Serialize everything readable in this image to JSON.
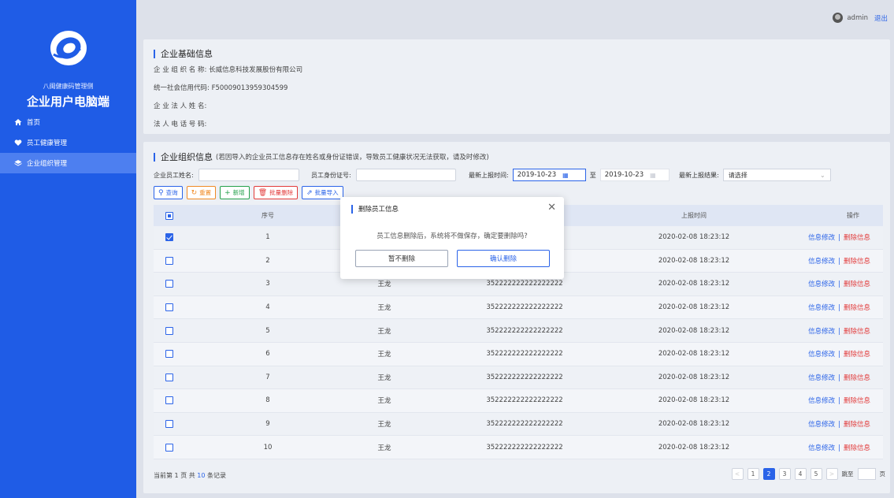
{
  "sidebar": {
    "org": "八闽健康码管理侧",
    "title": "企业用户电脑端",
    "items": [
      {
        "label": "首页",
        "icon": "home-icon"
      },
      {
        "label": "员工健康管理",
        "icon": "heart-icon"
      },
      {
        "label": "企业组织管理",
        "icon": "layers-icon"
      }
    ]
  },
  "topbar": {
    "user": "admin",
    "logout": "退出"
  },
  "basic": {
    "title": "企业基础信息",
    "rows": [
      "企 业 组 织 名 称:  长威信息科技发展股份有限公司",
      "统一社会信用代码:  F50009013959304599",
      "企 业 法 人 姓 名:",
      "法 人 电 话 号 码:"
    ]
  },
  "org": {
    "title": "企业组织信息",
    "note": "(若因导入的企业员工信息存在姓名或身份证错误，导致员工健康状况无法获取，请及时修改)",
    "filters": {
      "name_label": "企业员工姓名:",
      "id_label": "员工身份证号:",
      "date_label": "最新上报时间:",
      "date_from": "2019-10-23",
      "date_sep": "至",
      "date_to": "2019-10-23",
      "result_label": "最新上报结果:",
      "result_value": "请选择"
    },
    "buttons": {
      "query": "查询",
      "reset": "重置",
      "add": "新增",
      "batch_delete": "批量删除",
      "batch_import": "批量导入"
    },
    "table": {
      "headers": {
        "no": "序号",
        "time": "上报时间",
        "op": "操作"
      },
      "edit": "信息修改",
      "sep": "|",
      "delete": "删除信息",
      "rows": [
        {
          "no": "1",
          "name": "",
          "id": "",
          "time": "2020-02-08 18:23:12",
          "checked": true
        },
        {
          "no": "2",
          "name": "",
          "id": "",
          "time": "2020-02-08 18:23:12",
          "checked": false
        },
        {
          "no": "3",
          "name": "王龙",
          "id": "352222222222222222",
          "time": "2020-02-08 18:23:12",
          "checked": false
        },
        {
          "no": "4",
          "name": "王龙",
          "id": "352222222222222222",
          "time": "2020-02-08 18:23:12",
          "checked": false
        },
        {
          "no": "5",
          "name": "王龙",
          "id": "352222222222222222",
          "time": "2020-02-08 18:23:12",
          "checked": false
        },
        {
          "no": "6",
          "name": "王龙",
          "id": "352222222222222222",
          "time": "2020-02-08 18:23:12",
          "checked": false
        },
        {
          "no": "7",
          "name": "王龙",
          "id": "352222222222222222",
          "time": "2020-02-08 18:23:12",
          "checked": false
        },
        {
          "no": "8",
          "name": "王龙",
          "id": "352222222222222222",
          "time": "2020-02-08 18:23:12",
          "checked": false
        },
        {
          "no": "9",
          "name": "王龙",
          "id": "352222222222222222",
          "time": "2020-02-08 18:23:12",
          "checked": false
        },
        {
          "no": "10",
          "name": "王龙",
          "id": "352222222222222222",
          "time": "2020-02-08 18:23:12",
          "checked": false
        }
      ]
    },
    "footer": {
      "pre": "当前第",
      "page": "1",
      "mid": "页 共",
      "total": "10",
      "post": "条记录"
    },
    "pager": {
      "prev": "<",
      "pages": [
        "1",
        "2",
        "3",
        "4",
        "5"
      ],
      "current": "2",
      "next": ">",
      "goto_label": "跳至",
      "goto_suffix": "页"
    }
  },
  "modal": {
    "title": "删除员工信息",
    "message": "员工信息删除后，系统将不做保存，确定要删除吗?",
    "cancel": "暂不删除",
    "confirm": "确认删除"
  }
}
